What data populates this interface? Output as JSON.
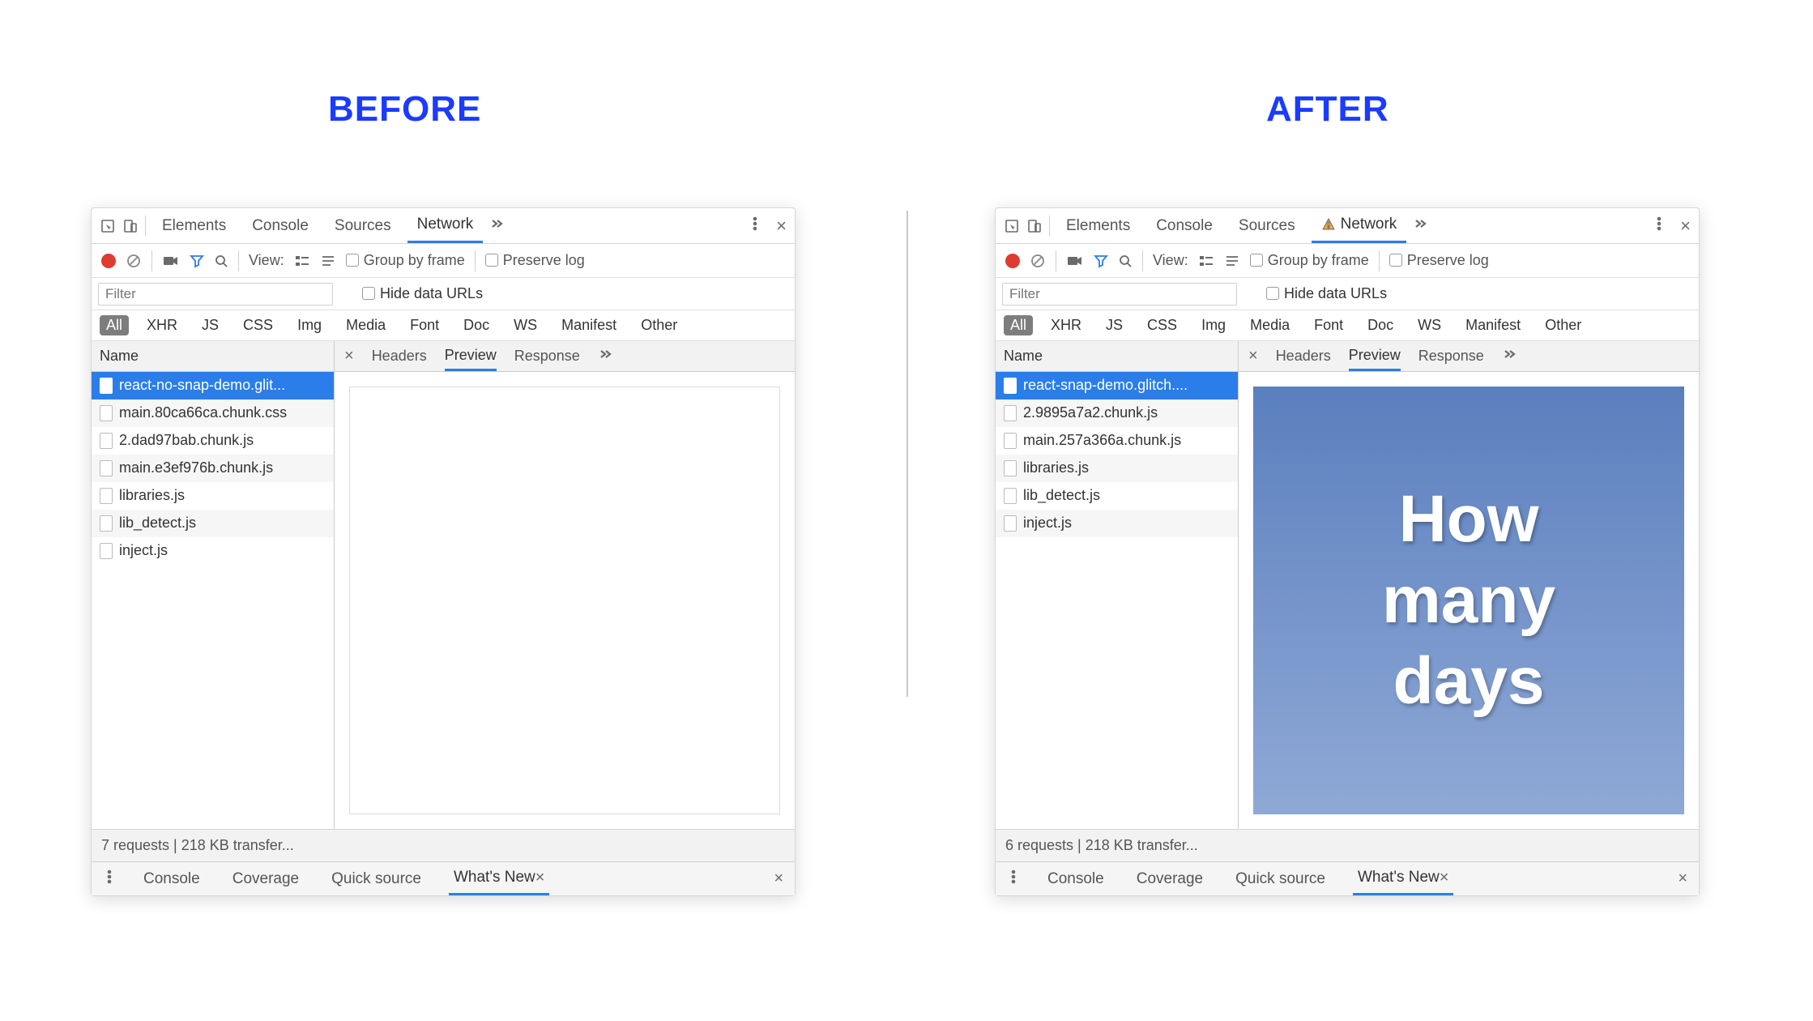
{
  "headings": {
    "before": "BEFORE",
    "after": "AFTER"
  },
  "tabs": [
    "Elements",
    "Console",
    "Sources",
    "Network"
  ],
  "activeTab": "Network",
  "toolbar": {
    "viewLabel": "View:",
    "group": "Group by frame",
    "preserve": "Preserve log"
  },
  "filter": {
    "placeholder": "Filter",
    "hide": "Hide data URLs"
  },
  "typeFilters": [
    "All",
    "XHR",
    "JS",
    "CSS",
    "Img",
    "Media",
    "Font",
    "Doc",
    "WS",
    "Manifest",
    "Other"
  ],
  "activeType": "All",
  "colName": "Name",
  "subtabs": [
    "Headers",
    "Preview",
    "Response"
  ],
  "activeSubtab": "Preview",
  "before": {
    "hasWarning": false,
    "files": [
      "react-no-snap-demo.glit...",
      "main.80ca66ca.chunk.css",
      "2.dad97bab.chunk.js",
      "main.e3ef976b.chunk.js",
      "libraries.js",
      "lib_detect.js",
      "inject.js"
    ],
    "previewText": "",
    "status": "7 requests | 218 KB transfer..."
  },
  "after": {
    "hasWarning": true,
    "files": [
      "react-snap-demo.glitch....",
      "2.9895a7a2.chunk.js",
      "main.257a366a.chunk.js",
      "libraries.js",
      "lib_detect.js",
      "inject.js"
    ],
    "previewText": "How\nmany\ndays",
    "status": "6 requests | 218 KB transfer..."
  },
  "drawer": {
    "tabs": [
      "Console",
      "Coverage",
      "Quick source",
      "What's New"
    ],
    "activeTab": "What's New"
  }
}
